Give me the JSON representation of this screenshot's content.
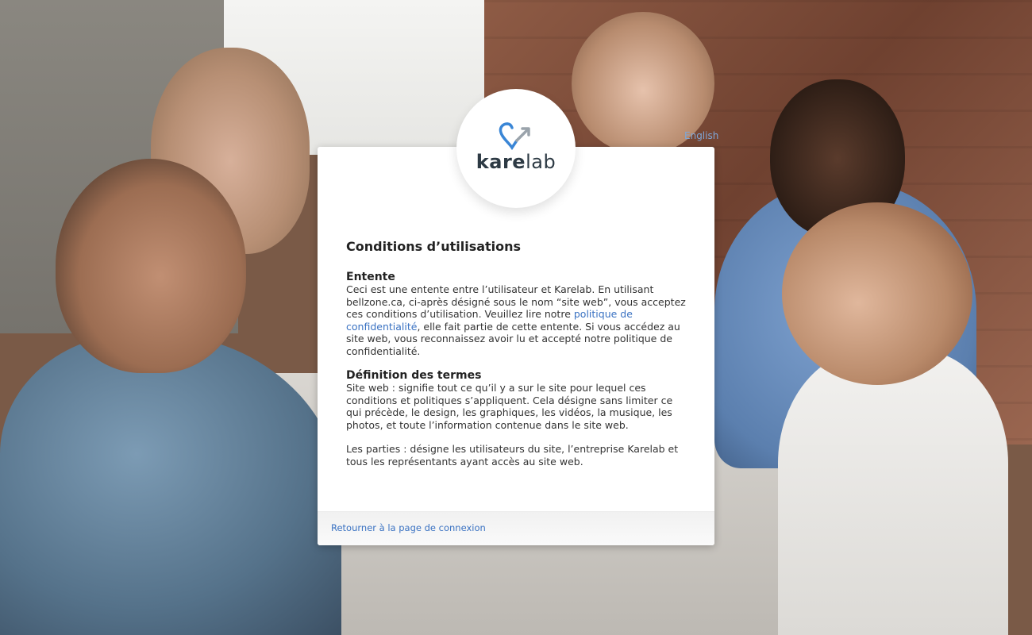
{
  "language_link": "English",
  "logo": {
    "text_bold": "kare",
    "text_regular": "lab",
    "heart_color": "#3a86d6",
    "arrow_color": "#9aa3ab"
  },
  "terms": {
    "title": "Conditions d’utilisations",
    "sections": [
      {
        "heading": "Entente",
        "paragraph_before_link": "Ceci est une entente entre l’utilisateur et Karelab. En utilisant bellzone.ca, ci-après désigné sous le nom “site web”, vous acceptez ces conditions d’utilisation. Veuillez lire notre ",
        "link_text": "politique de confidentialité",
        "paragraph_after_link": ", elle fait partie de cette entente. Si vous accédez au site web, vous reconnaissez avoir lu et accepté notre politique de confidentialité."
      },
      {
        "heading": "Définition des termes",
        "paragraph_1": "Site web :  signifie tout ce qu’il y a sur le site pour lequel ces conditions et politiques s’appliquent. Cela désigne sans limiter ce qui précède, le design, les graphiques, les vidéos, la musique, les photos, et toute l’information contenue dans le site web.",
        "paragraph_2": "Les parties : désigne les utilisateurs du site, l’entreprise Karelab et tous les représentants ayant accès au site web."
      }
    ]
  },
  "footer": {
    "back_link": "Retourner à la page de connexion"
  },
  "colors": {
    "link": "#3a72c2",
    "language_link": "#7fa6d6"
  }
}
